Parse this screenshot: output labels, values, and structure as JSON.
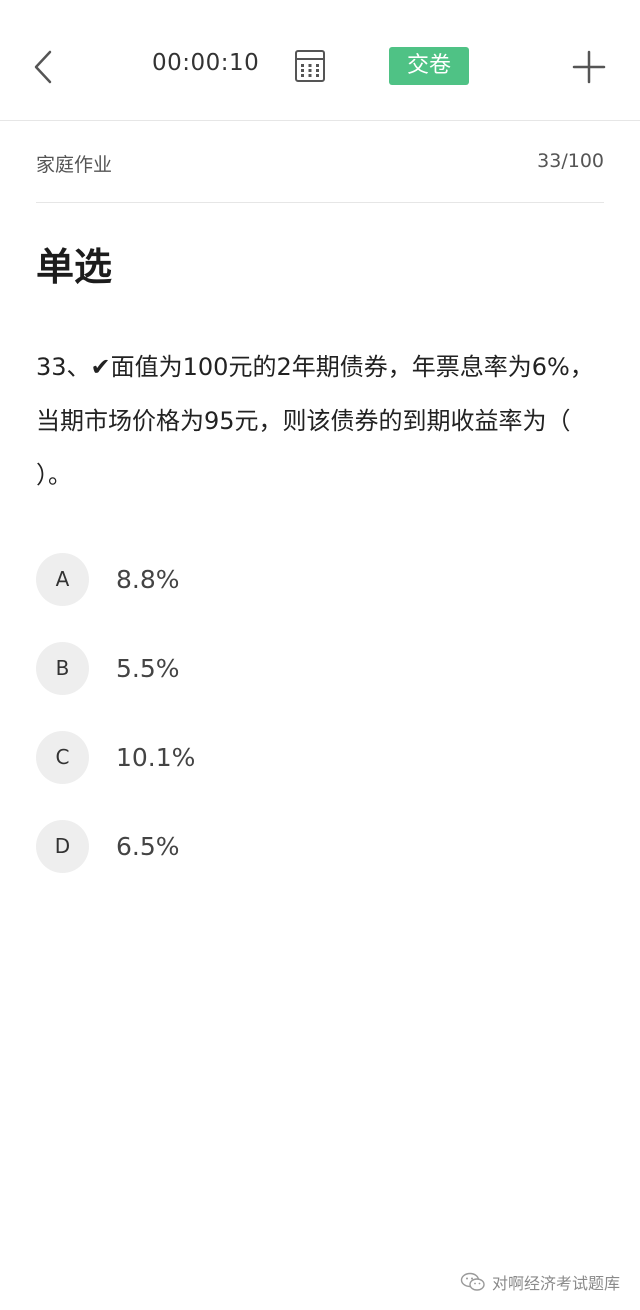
{
  "topbar": {
    "back_icon": "chevron-left-icon",
    "timer": "00:00:10",
    "answer_card_icon": "grid-card-icon",
    "submit_label": "交卷",
    "submit_color": "#4fc285",
    "plus_icon": "plus-icon"
  },
  "subheader": {
    "label": "家庭作业",
    "progress": "33/100"
  },
  "question": {
    "type": "单选",
    "text": "33、✔面值为100元的2年期债券，年票息率为6%，当期市场价格为95元，则该债券的到期收益率为（ ）。",
    "options": [
      {
        "letter": "A",
        "text": "8.8%"
      },
      {
        "letter": "B",
        "text": "5.5%"
      },
      {
        "letter": "C",
        "text": "10.1%"
      },
      {
        "letter": "D",
        "text": "6.5%"
      }
    ]
  },
  "watermark": {
    "icon": "wechat-icon",
    "text": "对啊经济考试题库"
  }
}
